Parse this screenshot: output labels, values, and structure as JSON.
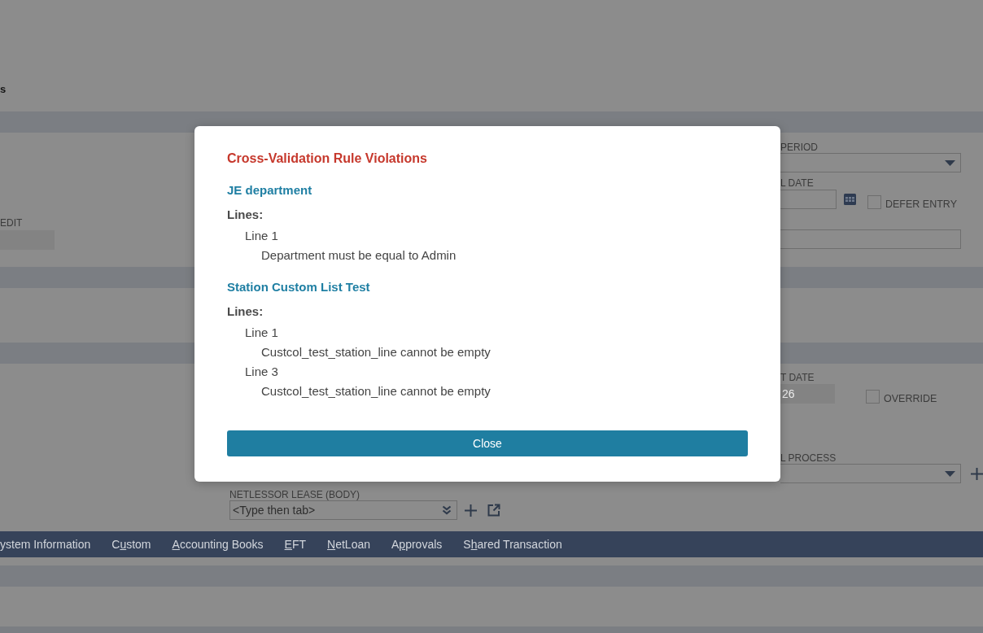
{
  "page_title": "s",
  "main_section": {
    "left_field": {
      "kind": "readonly",
      "label": "EDIT"
    },
    "right_fields": [
      {
        "kind": "select",
        "label": "PERIOD"
      },
      {
        "kind": "date",
        "label": "L DATE",
        "checkbox": {
          "label": "DEFER ENTRY",
          "checked": false
        }
      },
      {
        "kind": "text"
      }
    ]
  },
  "lower_section": {
    "right_fields": [
      {
        "kind": "readonly",
        "label": "T DATE",
        "value": "26",
        "checkbox": {
          "label": "OVERRIDE",
          "checked": false
        }
      },
      {
        "kind": "select",
        "label": "L PROCESS",
        "add_button": true
      }
    ],
    "middle_field": {
      "kind": "lookup",
      "label": "NETLESSOR LEASE (BODY)",
      "placeholder": "<Type then tab>",
      "add_button": true,
      "open_button": true
    }
  },
  "subtabs": [
    {
      "before": "ystem Information",
      "selected": false
    },
    {
      "before": "C",
      "key": "u",
      "after": "stom",
      "selected": false
    },
    {
      "key": "A",
      "after": "ccounting Books",
      "selected": false
    },
    {
      "key": "E",
      "after": "FT",
      "selected": false
    },
    {
      "key": "N",
      "after": "etLoan",
      "selected": false
    },
    {
      "before": "A",
      "key": "p",
      "after": "provals",
      "selected": false
    },
    {
      "before": "S",
      "key": "h",
      "after": "ared Transaction",
      "selected": false
    }
  ],
  "dialog": {
    "title": "Cross-Validation Rule Violations",
    "rules": [
      {
        "name": "JE department",
        "lines_heading": "Lines:",
        "lines": [
          {
            "label": "Line 1",
            "messages": [
              "Department must be equal to Admin"
            ]
          }
        ]
      },
      {
        "name": "Station Custom List Test",
        "lines_heading": "Lines:",
        "lines": [
          {
            "label": "Line 1",
            "messages": [
              "Custcol_test_station_line cannot be empty"
            ]
          },
          {
            "label": "Line 3",
            "messages": [
              "Custcol_test_station_line cannot be empty"
            ]
          }
        ]
      }
    ],
    "close_button": "Close"
  }
}
